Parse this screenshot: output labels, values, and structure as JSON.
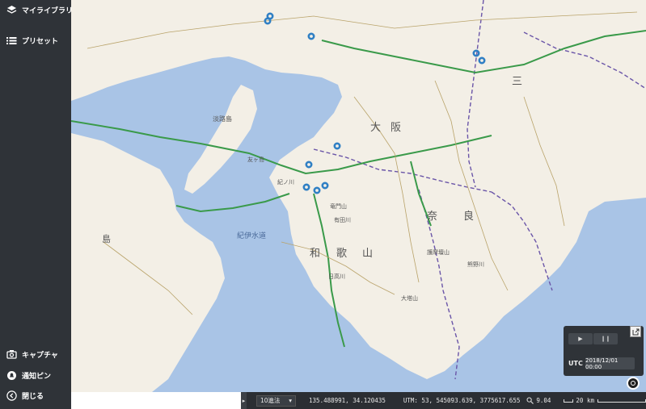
{
  "sidebar": {
    "items_top": [
      {
        "label": "マイライブラリ",
        "icon": "layers-icon"
      },
      {
        "label": "プリセット",
        "icon": "list-icon"
      }
    ],
    "items_bottom": [
      {
        "label": "キャプチャ",
        "icon": "camera-icon"
      },
      {
        "label": "通知ピン",
        "icon": "pin-icon"
      },
      {
        "label": "閉じる",
        "icon": "chevron-left-icon"
      }
    ]
  },
  "map": {
    "labels": {
      "osaka": "大",
      "osaka2": "阪",
      "wakayama1": "和",
      "wakayama2": "歌",
      "wakayama3": "山",
      "nara1": "奈",
      "nara2": "良",
      "mie": "三",
      "awaji": "淡路島",
      "island": "島",
      "kii": "紀伊水道",
      "ranges": [
        "紀ノ川",
        "竜門山",
        "護摩壇山",
        "大塔山",
        "熊野川",
        "有田川",
        "日高川",
        "友ヶ島"
      ]
    },
    "colors": {
      "sea": "#a9c4e6",
      "land": "#f3efe6",
      "road": "#3a9a4a",
      "boundary": "#6a55a8",
      "marker": "#2f7fc4"
    }
  },
  "status_bar": {
    "toggle_icon": "▸",
    "projection": "10進法",
    "coords": "135.488991, 34.120435",
    "utm": "UTM: 53, 545093.639, 3775617.655",
    "zoom": "9.04",
    "scale": "20 km"
  },
  "time_panel": {
    "play_icon": "▶",
    "pause_icon": "❙❙",
    "utc_label": "UTC",
    "datetime": "2018/12/01 00:00"
  }
}
